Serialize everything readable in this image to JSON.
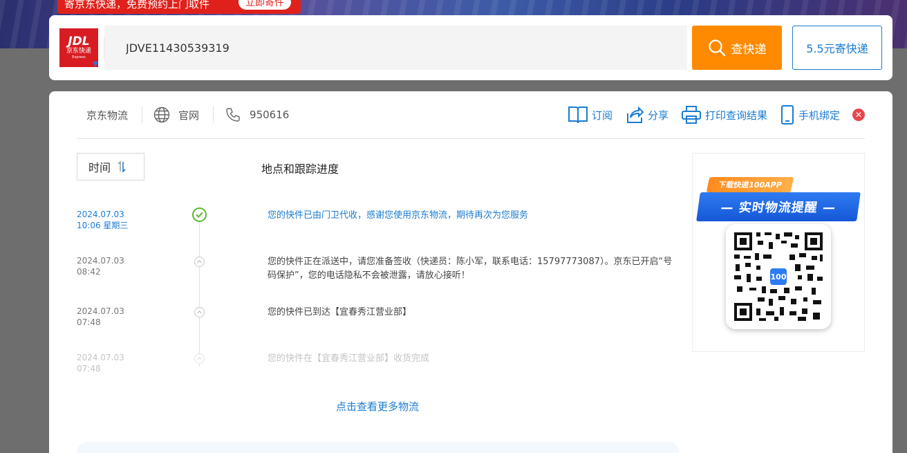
{
  "promo": {
    "text": "寄京东快递，免费预约上门取件",
    "button": "立即寄件"
  },
  "search": {
    "logo_main": "JDL",
    "logo_sub": "京东快递",
    "logo_en": "Express",
    "tracking_number": "JDVE11430539319",
    "query_button": "查快递",
    "send_button": "5.5元寄快递"
  },
  "toolbar": {
    "carrier": "京东物流",
    "website": "官网",
    "phone": "950616",
    "subscribe": "订阅",
    "share": "分享",
    "print": "打印查询结果",
    "bind_phone": "手机绑定"
  },
  "table": {
    "sort_label": "时间",
    "column_title": "地点和跟踪进度"
  },
  "timeline": [
    {
      "date": "2024.07.03",
      "time": "10:06 星期三",
      "text": "您的快件已由门卫代收，感谢您使用京东物流，期待再次为您服务"
    },
    {
      "date": "2024.07.03",
      "time": "08:42",
      "text": "您的快件正在派送中，请您准备签收（快递员：陈小军，联系电话：15797773087）。京东已开启“号码保护”，您的电话隐私不会被泄露，请放心接听！"
    },
    {
      "date": "2024.07.03",
      "time": "07:48",
      "text": "您的快件已到达【宜春秀江营业部】"
    },
    {
      "date": "2024.07.03",
      "time": "07:48",
      "text": "您的快件在【宜春秀江营业部】收货完成"
    }
  ],
  "more_link": "点击查看更多物流",
  "qr": {
    "tag": "下载快递100APP",
    "banner": "— 实时物流提醒 —",
    "logo": "100"
  },
  "colors": {
    "accent_orange": "#ff8a00",
    "link_blue": "#1a7bd1",
    "jd_red": "#d71d22",
    "delivered_green": "#5bb82a"
  }
}
